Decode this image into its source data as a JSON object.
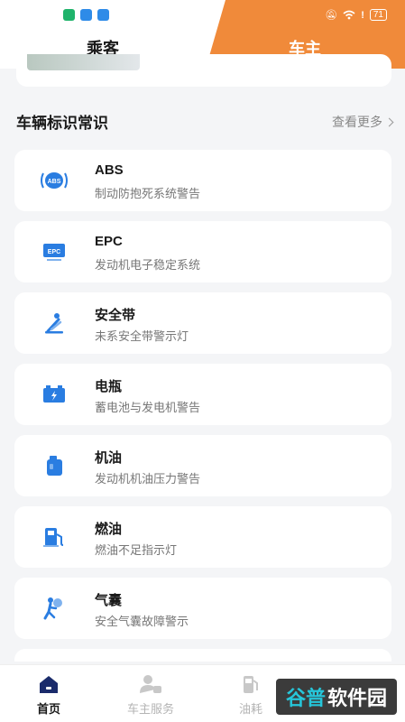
{
  "header": {
    "tab_passenger": "乘客",
    "tab_owner": "车主",
    "battery": "71"
  },
  "section": {
    "title": "车辆标识常识",
    "see_more": "查看更多"
  },
  "items": [
    {
      "name": "ABS",
      "desc": "制动防抱死系统警告",
      "icon": "abs-icon"
    },
    {
      "name": "EPC",
      "desc": "发动机电子稳定系统",
      "icon": "epc-icon"
    },
    {
      "name": "安全带",
      "desc": "未系安全带警示灯",
      "icon": "seatbelt-icon"
    },
    {
      "name": "电瓶",
      "desc": "蓄电池与发电机警告",
      "icon": "battery-icon"
    },
    {
      "name": "机油",
      "desc": "发动机机油压力警告",
      "icon": "oil-icon"
    },
    {
      "name": "燃油",
      "desc": "燃油不足指示灯",
      "icon": "fuel-icon"
    },
    {
      "name": "气囊",
      "desc": "安全气囊故障警示",
      "icon": "airbag-icon"
    }
  ],
  "nav": {
    "home": "首页",
    "service": "车主服务",
    "fuel": "油耗"
  },
  "watermark": {
    "part1": "谷普",
    "part2": "软件园"
  },
  "colors": {
    "accent": "#f08a3a",
    "icon_blue": "#2a7de1"
  }
}
